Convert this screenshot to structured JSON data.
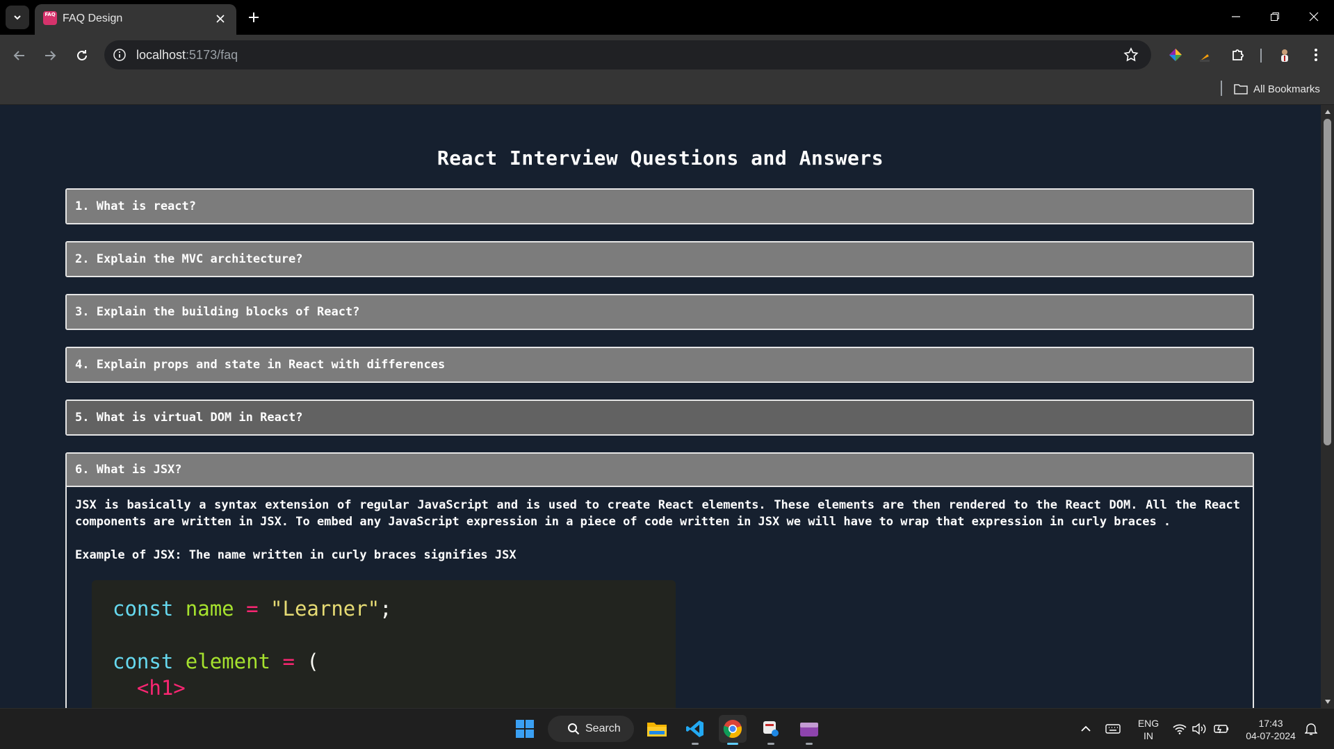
{
  "browser": {
    "tab_title": "FAQ Design",
    "tab_favicon_text": "FAQ",
    "url_host": "localhost",
    "url_path": ":5173/faq",
    "bookmarks_label": "All Bookmarks"
  },
  "page": {
    "title": "React Interview Questions and Answers",
    "faqs": [
      {
        "question": "1. What is react?"
      },
      {
        "question": "2. Explain the MVC architecture?"
      },
      {
        "question": "3. Explain the building blocks of React?"
      },
      {
        "question": "4. Explain props and state in React with differences"
      },
      {
        "question": "5. What is virtual DOM in React?"
      },
      {
        "question": "6. What is JSX?"
      }
    ],
    "open_answer": {
      "paragraph": "JSX is basically a syntax extension of regular JavaScript and is used to create React elements. These elements are then rendered to the React DOM. All the React components are written in JSX. To embed any JavaScript expression in a piece of code written in JSX we will have to wrap that expression in curly braces .",
      "example_label": "Example of JSX: The name written in curly braces signifies JSX",
      "code": {
        "line1_kw": "const",
        "line1_var": "name",
        "line1_op": "=",
        "line1_str": "\"Learner\"",
        "line1_end": ";",
        "line3_kw": "const",
        "line3_var": "element",
        "line3_op": "=",
        "line3_paren": "(",
        "line4_tag": "<h1>"
      }
    }
  },
  "taskbar": {
    "search_label": "Search",
    "lang_top": "ENG",
    "lang_bottom": "IN",
    "time": "17:43",
    "date": "04-07-2024"
  },
  "colors": {
    "page_bg": "#16202f",
    "question_bg": "#7c7c7c",
    "question_hover_bg": "#626262",
    "code_bg": "#22241f"
  }
}
